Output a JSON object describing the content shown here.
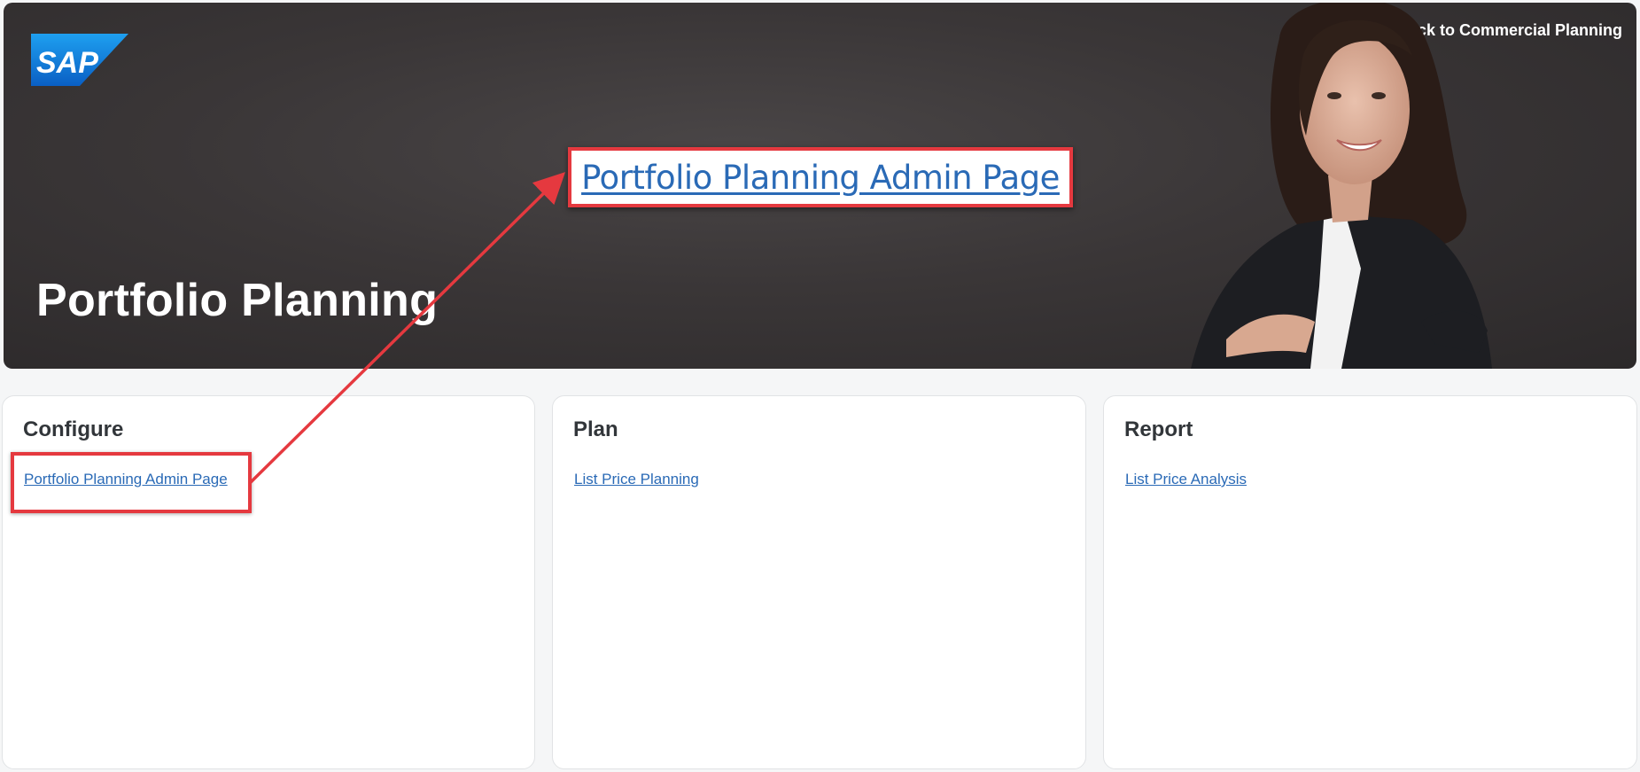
{
  "header": {
    "logo_text": "SAP",
    "back_label": "Back to Commercial Planning",
    "title": "Portfolio Planning"
  },
  "callout": {
    "label": "Portfolio Planning Admin Page"
  },
  "cards": [
    {
      "title": "Configure",
      "link": "Portfolio Planning Admin Page"
    },
    {
      "title": "Plan",
      "link": "List Price Planning"
    },
    {
      "title": "Report",
      "link": "List Price Analysis"
    }
  ],
  "colors": {
    "link": "#2a6ab6",
    "callout_border": "#e5393f",
    "hero_background": "#3a3637"
  }
}
